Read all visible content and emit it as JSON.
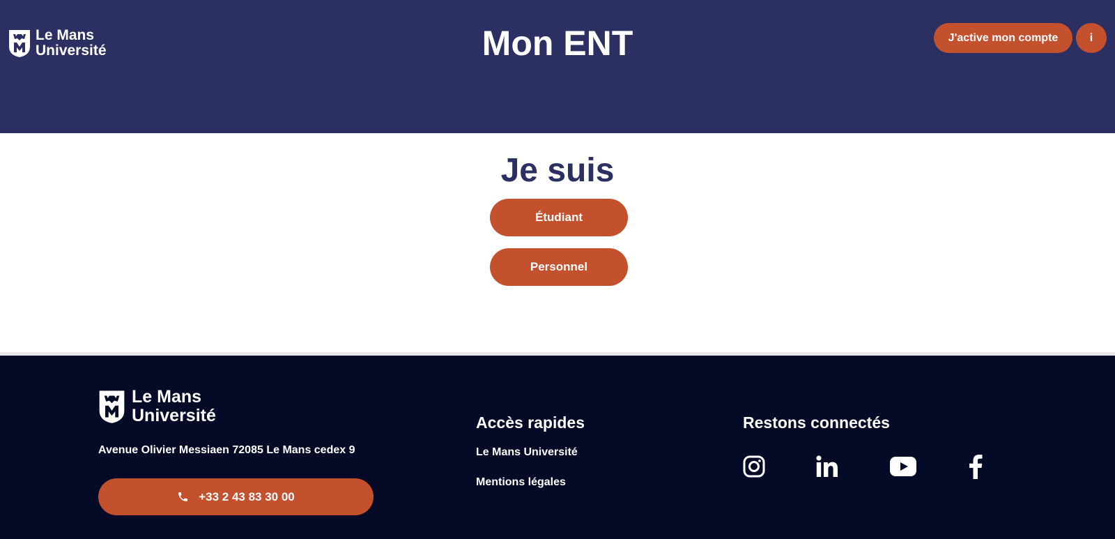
{
  "header": {
    "logo_line1": "Le Mans",
    "logo_line2": "Université",
    "title": "Mon ENT",
    "activate_label": "J'active mon compte",
    "info_label": "i"
  },
  "main": {
    "title": "Je suis",
    "roles": [
      {
        "label": "Étudiant"
      },
      {
        "label": "Personnel"
      }
    ]
  },
  "footer": {
    "logo_line1": "Le Mans",
    "logo_line2": "Université",
    "address": "Avenue Olivier Messiaen 72085 Le Mans cedex 9",
    "phone": "+33 2 43 83 30 00",
    "quick_access": {
      "heading": "Accès rapides",
      "links": [
        "Le Mans Université",
        "Mentions légales"
      ]
    },
    "social": {
      "heading": "Restons connectés",
      "icons": [
        "instagram-icon",
        "linkedin-icon",
        "youtube-icon",
        "facebook-icon"
      ]
    }
  },
  "colors": {
    "header_bg": "#2b2f62",
    "accent": "#c4512e",
    "footer_bg": "#050a26",
    "title_text": "#2b2f62"
  }
}
